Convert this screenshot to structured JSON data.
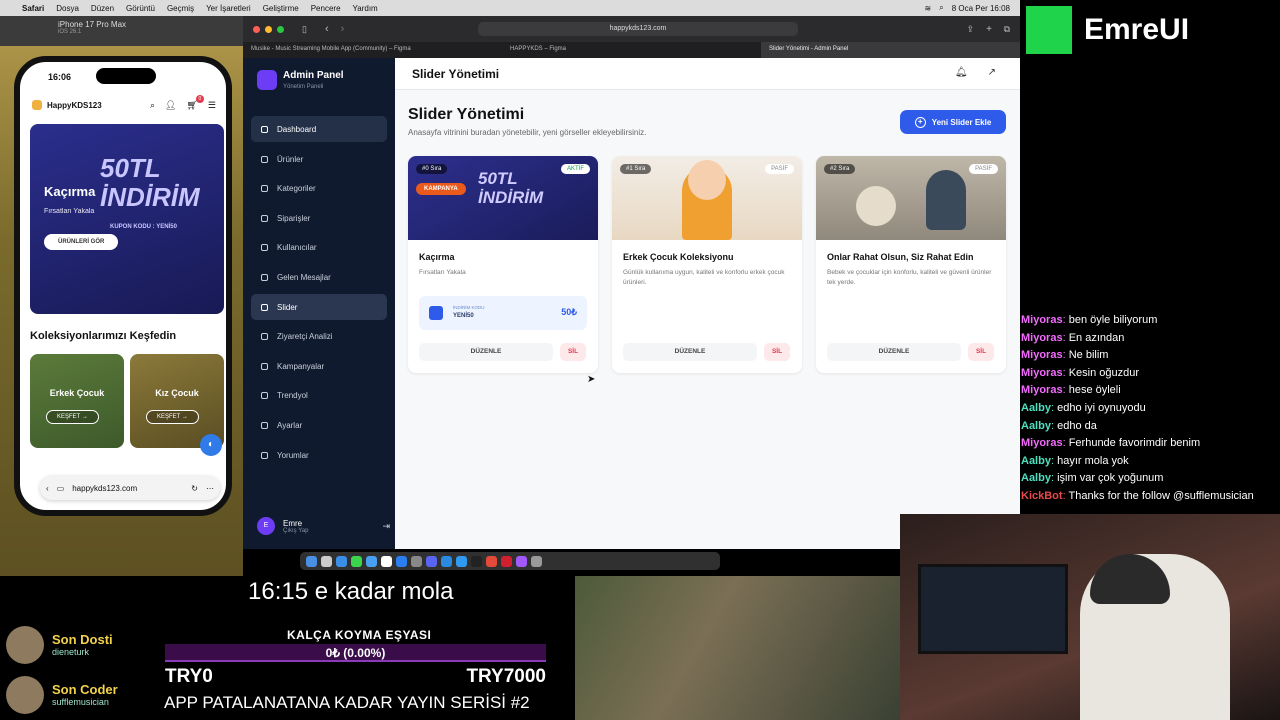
{
  "mac_menu": {
    "apple": "",
    "items": [
      "Safari",
      "Dosya",
      "Düzen",
      "Görüntü",
      "Geçmiş",
      "Yer İşaretleri",
      "Geliştirme",
      "Pencere",
      "Yardım"
    ],
    "clock": "8 Oca Per 16:08"
  },
  "simulator": {
    "device": "iPhone 17 Pro Max",
    "os": "iOS 26.1"
  },
  "phone": {
    "time": "16:06",
    "brand": "HappyKDS123",
    "cart_count": "0",
    "banner": {
      "title": "Kaçırma",
      "subtitle": "Fırsatları Yakala",
      "button": "ÜRÜNLERİ GÖR",
      "headline": "50TL İNDİRİM",
      "code": "KUPON KODU : YENİ50"
    },
    "collections_title": "Koleksiyonlarımızı Keşfedin",
    "collections": [
      {
        "label": "Erkek Çocuk",
        "action": "KEŞFET →"
      },
      {
        "label": "Kız Çocuk",
        "action": "KEŞFET →"
      }
    ],
    "url": "happykds123.com"
  },
  "browser": {
    "address": "happykds123.com",
    "tabs": [
      {
        "label": "Musike - Music Streaming Mobile App (Community) – Figma",
        "active": false
      },
      {
        "label": "HAPPYKDS – Figma",
        "active": false
      },
      {
        "label": "Slider Yönetimi - Admin Panel",
        "active": true
      }
    ]
  },
  "sidebar": {
    "app_title": "Admin Panel",
    "app_subtitle": "Yönetim Paneli",
    "items": [
      {
        "label": "Dashboard",
        "active": false,
        "highlight": true
      },
      {
        "label": "Ürünler",
        "active": false
      },
      {
        "label": "Kategoriler",
        "active": false
      },
      {
        "label": "Siparişler",
        "active": false
      },
      {
        "label": "Kullanıcılar",
        "active": false
      },
      {
        "label": "Gelen Mesajlar",
        "active": false
      },
      {
        "label": "Slider",
        "active": true
      },
      {
        "label": "Ziyaretçi Analizi",
        "active": false
      },
      {
        "label": "Kampanyalar",
        "active": false
      },
      {
        "label": "Trendyol",
        "active": false
      },
      {
        "label": "Ayarlar",
        "active": false
      },
      {
        "label": "Yorumlar",
        "active": false
      }
    ],
    "user": {
      "initial": "E",
      "name": "Emre",
      "action": "Çıkış Yap"
    }
  },
  "main": {
    "topbar_title": "Slider Yönetimi",
    "page_title": "Slider Yönetimi",
    "page_subtitle": "Anasayfa vitrinini buradan yönetebilir, yeni görseller ekleyebilirsiniz.",
    "add_button": "Yeni Slider Ekle",
    "cards": [
      {
        "seq": "#0 Sıra",
        "status": "AKTİF",
        "tag": "KAMPANYA",
        "image_text": "50TL İNDİRİM",
        "title": "Kaçırma",
        "desc": "Fırsatları Yakala",
        "coupon_label": "İNDİRİM KODU",
        "coupon_code": "YENİ50",
        "coupon_amount": "50₺",
        "edit": "DÜZENLE",
        "delete": "SİL"
      },
      {
        "seq": "#1 Sıra",
        "status": "PASİF",
        "title": "Erkek Çocuk Koleksiyonu",
        "desc": "Günlük kullanıma uygun, kaliteli ve konforlu erkek çocuk ürünleri.",
        "edit": "DÜZENLE",
        "delete": "SİL"
      },
      {
        "seq": "#2 Sıra",
        "status": "PASİF",
        "title": "Onlar Rahat Olsun, Siz Rahat Edin",
        "desc": "Bebek ve çocuklar için konforlu, kaliteli ve güvenli ürünler tek yerde.",
        "edit": "DÜZENLE",
        "delete": "SİL"
      }
    ]
  },
  "stream": {
    "logo": "EmreUI",
    "chat": [
      {
        "user": "Miyoras",
        "msg": "ben öyle biliyorum"
      },
      {
        "user": "Miyoras",
        "msg": "En azından"
      },
      {
        "user": "Miyoras",
        "msg": "Ne bilim"
      },
      {
        "user": "Miyoras",
        "msg": "Kesin oğuzdur"
      },
      {
        "user": "Miyoras",
        "msg": "hese öyleli"
      },
      {
        "user": "Aalby",
        "msg": "edho iyi oynuyodu"
      },
      {
        "user": "Aalby",
        "msg": "edho da"
      },
      {
        "user": "Miyoras",
        "msg": "Ferhunde favorimdir benim"
      },
      {
        "user": "Aalby",
        "msg": "hayır mola yok"
      },
      {
        "user": "Aalby",
        "msg": "işim var çok yoğunum"
      },
      {
        "user": "KickBot",
        "msg": "Thanks for the follow @sufflemusician"
      }
    ],
    "break_text": "16:15 e kadar mola",
    "goal_title": "KALÇA KOYMA EŞYASI",
    "goal_progress": "0₺ (0.00%)",
    "goal_progress_value": 0.0,
    "goal_min": "TRY0",
    "goal_max": "TRY7000",
    "series_text": "APP PATALANATANA KADAR YAYIN SERİSİ #2",
    "supporters": [
      {
        "role": "Son Dosti",
        "name": "dieneturk"
      },
      {
        "role": "Son Coder",
        "name": "sufflemusician"
      }
    ]
  },
  "colors": {
    "accent": "#2f5bea",
    "sidebar_bg": "#101a2e",
    "active_green": "#17a34a",
    "delete_red": "#e23b4f",
    "brand_green": "#1fd44a"
  }
}
